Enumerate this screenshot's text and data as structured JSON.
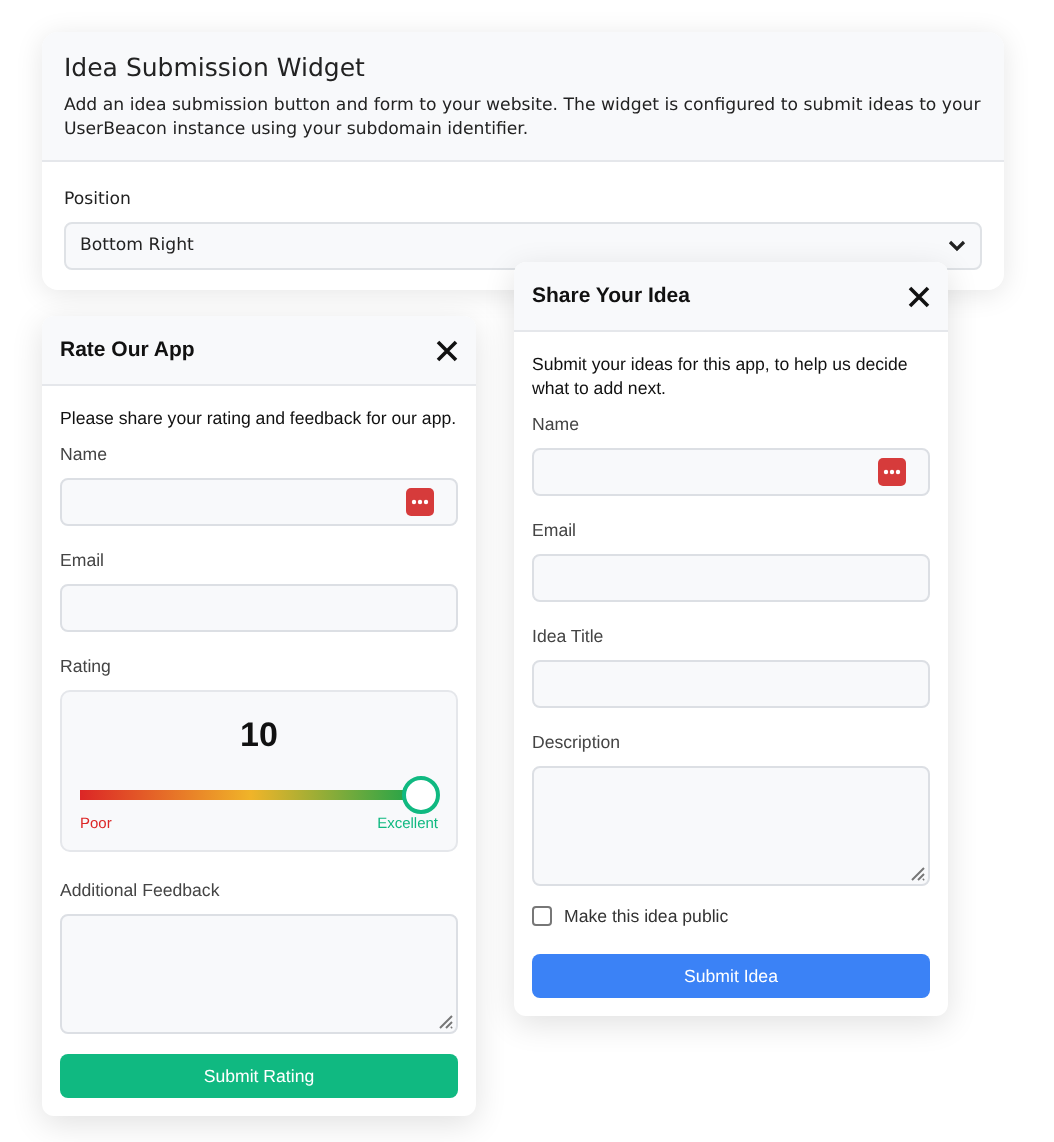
{
  "settings": {
    "title": "Idea Submission Widget",
    "description": "Add an idea submission button and form to your website. The widget is configured to submit ideas to your UserBeacon instance using your subdomain identifier.",
    "position": {
      "label": "Position",
      "value": "Bottom Right"
    }
  },
  "rating_widget": {
    "title": "Rate Our App",
    "intro": "Please share your rating and feedback for our app.",
    "fields": [
      {
        "kind": "text",
        "label": "Name",
        "autofill_icon": true
      },
      {
        "kind": "text",
        "label": "Email",
        "autofill_icon": false
      },
      {
        "kind": "rating",
        "label": "Rating",
        "value": "10",
        "level": 1,
        "min_label": "Poor",
        "max_label": "Excellent"
      },
      {
        "kind": "textarea",
        "label": "Additional Feedback"
      }
    ],
    "submit": "Submit Rating"
  },
  "idea_widget": {
    "title": "Share Your Idea",
    "intro": "Submit your ideas for this app, to help us decide what to add next.",
    "fields": [
      {
        "kind": "text",
        "label": "Name",
        "autofill_icon": true
      },
      {
        "kind": "text",
        "label": "Email",
        "autofill_icon": false
      },
      {
        "kind": "text",
        "label": "Idea Title",
        "autofill_icon": false
      },
      {
        "kind": "textarea",
        "label": "Description"
      },
      {
        "kind": "checkbox",
        "label": "Make this idea public",
        "checked": false
      }
    ],
    "submit": "Submit Idea"
  }
}
